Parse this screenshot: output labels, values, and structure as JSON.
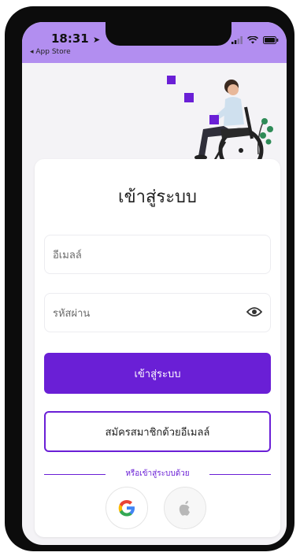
{
  "status_bar": {
    "time": "18:31",
    "back_to_app": "◂ App Store"
  },
  "login": {
    "title": "เข้าสู่ระบบ",
    "email_placeholder": "อีเมลล์",
    "password_placeholder": "รหัสผ่าน",
    "login_button": "เข้าสู่ระบบ",
    "register_button": "สมัครสมาชิกด้วยอีเมลล์",
    "divider_text": "หรือเข้าสู่ระบบด้วย"
  },
  "social": [
    "google-icon",
    "apple-icon"
  ],
  "colors": {
    "accent": "#6a1fd6",
    "statusbar": "#b28ef0"
  }
}
